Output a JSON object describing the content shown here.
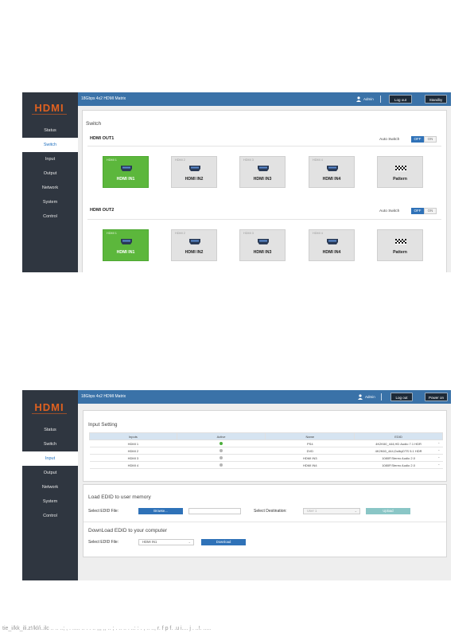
{
  "shot1": {
    "logo_text": "HDMI",
    "nav": [
      "Status",
      "Switch",
      "Input",
      "Output",
      "Network",
      "System",
      "Control"
    ],
    "app_title": "18Gbps 4x2 HDMI Matrix",
    "user": "Admin",
    "logout": "Log out",
    "standby": "Standby",
    "panel_title": "Switch",
    "outputs": [
      {
        "title": "HDMI OUT1",
        "auto_label": "Auto Switch",
        "off": "OFF",
        "on": "ON",
        "tiles": [
          {
            "small": "HDMI 1",
            "big": "HDMI IN1",
            "icon": "hdmi-port-icon",
            "selected": true
          },
          {
            "small": "HDMI 2",
            "big": "HDMI IN2",
            "icon": "hdmi-port-icon",
            "selected": false
          },
          {
            "small": "HDMI 3",
            "big": "HDMI IN3",
            "icon": "hdmi-port-icon",
            "selected": false
          },
          {
            "small": "HDMI 4",
            "big": "HDMI IN4",
            "icon": "hdmi-port-icon",
            "selected": false
          },
          {
            "small": "",
            "big": "Pattern",
            "icon": "checkerboard-pattern-icon",
            "selected": false
          }
        ]
      },
      {
        "title": "HDMI OUT2",
        "auto_label": "Auto Switch",
        "off": "OFF",
        "on": "ON",
        "tiles": [
          {
            "small": "HDMI 1",
            "big": "HDMI IN1",
            "icon": "hdmi-port-icon",
            "selected": true
          },
          {
            "small": "HDMI 2",
            "big": "HDMI IN2",
            "icon": "hdmi-port-icon",
            "selected": false
          },
          {
            "small": "HDMI 3",
            "big": "HDMI IN3",
            "icon": "hdmi-port-icon",
            "selected": false
          },
          {
            "small": "HDMI 4",
            "big": "HDMI IN4",
            "icon": "hdmi-port-icon",
            "selected": false
          },
          {
            "small": "",
            "big": "Pattern",
            "icon": "checkerboard-pattern-icon",
            "selected": false
          }
        ]
      }
    ],
    "colors": {
      "selected_tile": "#5cb73c",
      "toggle_off": "#2f72b8",
      "topbar": "#3a72a8",
      "sidebar": "#2f3640"
    }
  },
  "shot2": {
    "logo_text": "HDMI",
    "nav": [
      "Status",
      "Switch",
      "Input",
      "Output",
      "Network",
      "System",
      "Control"
    ],
    "app_title": "18Gbps 4x2 HDMI Matrix",
    "user": "Admin",
    "logout": "Log out",
    "power": "Power on",
    "input_title": "Input Setting",
    "table_headers": [
      "Inputs",
      "Active",
      "Name",
      "EDID"
    ],
    "rows": [
      {
        "input": "HDMI 1",
        "active": true,
        "name": "PS4",
        "edid": "4K2K60_444,HD Audio 7.1 HDR"
      },
      {
        "input": "HDMI 2",
        "active": false,
        "name": "DVD",
        "edid": "4K2K60_444,DolbyDTS 5.1 HDR"
      },
      {
        "input": "HDMI 3",
        "active": false,
        "name": "HDMI IN3",
        "edid": "1080P,Stereo Audio 2.0"
      },
      {
        "input": "HDMI 4",
        "active": false,
        "name": "HDMI IN4",
        "edid": "1080P,Stereo Audio 2.0"
      }
    ],
    "load_title": "Load EDID to user memory",
    "select_edid_label": "Select EDID File:",
    "browse": "Browse...",
    "select_dest_label": "Select Destination:",
    "dest_value": "User 1",
    "upload": "Upload",
    "download_title": "DownLoad EDID to your computer",
    "select_edid_label2": "Select EDID File:",
    "edid_value": "HDMI IN1",
    "download": "Download",
    "colors": {
      "active_dot": "#4cae3c",
      "inactive_dot": "#b5b5b5",
      "header_bg": "#d6e4f1",
      "upload": "#8ac6c6"
    }
  },
  "bottom_text": "tie_i/kk_ili.z!/kl/i..ilc .. .. ..; , . ..... .. . . .. ,,, ,, .. ; . .. .. . ..: : . , .. ..,  r. f p f. .u i.... j . ..!. ....."
}
